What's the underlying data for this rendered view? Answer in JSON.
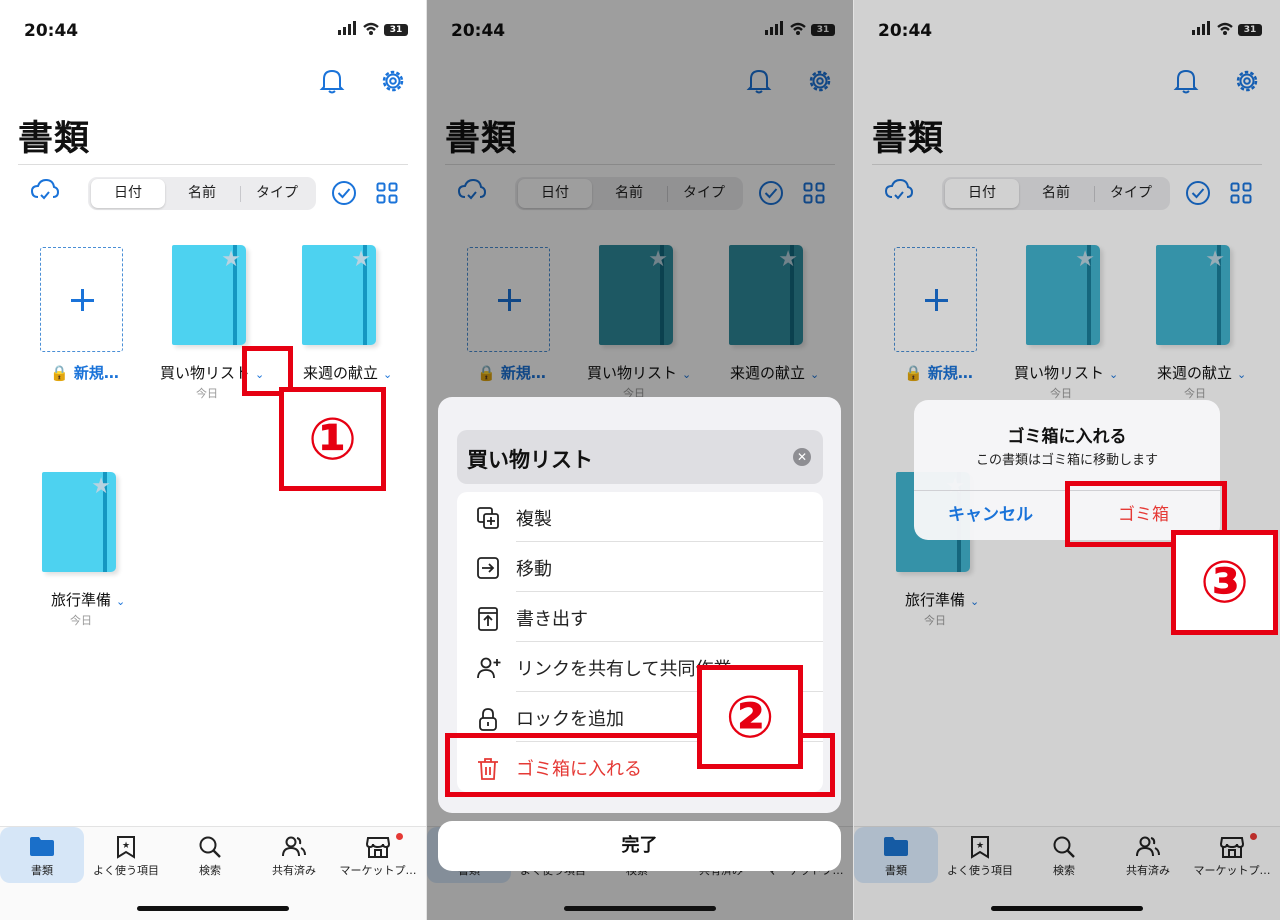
{
  "status": {
    "time": "20:44",
    "battery": "31"
  },
  "docs": {
    "title": "書類",
    "segments": [
      "日付",
      "名前",
      "タイプ"
    ],
    "new_label": "新規…",
    "notebooks": [
      {
        "name": "買い物リスト",
        "date": "今日"
      },
      {
        "name": "来週の献立",
        "date": "今日"
      },
      {
        "name": "旅行準備",
        "date": "今日"
      }
    ]
  },
  "tabs": [
    {
      "label": "書類",
      "icon": "folder-icon"
    },
    {
      "label": "よく使う項目",
      "icon": "bookmark-star-icon"
    },
    {
      "label": "検索",
      "icon": "search-icon"
    },
    {
      "label": "共有済み",
      "icon": "people-icon"
    },
    {
      "label": "マーケットプ…",
      "icon": "store-icon"
    }
  ],
  "sheet": {
    "title": "買い物リスト",
    "items": [
      {
        "label": "複製",
        "icon": "duplicate-icon"
      },
      {
        "label": "移動",
        "icon": "move-icon"
      },
      {
        "label": "書き出す",
        "icon": "export-icon"
      },
      {
        "label": "リンクを共有して共同作業",
        "icon": "add-person-icon"
      },
      {
        "label": "ロックを追加",
        "icon": "lock-icon"
      },
      {
        "label": "ゴミ箱に入れる",
        "icon": "trash-icon"
      }
    ],
    "done": "完了"
  },
  "alert": {
    "title": "ゴミ箱に入れる",
    "message": "この書類はゴミ箱に移動します",
    "cancel": "キャンセル",
    "confirm": "ゴミ箱"
  },
  "annotations": [
    "①",
    "②",
    "③"
  ],
  "colors": {
    "accent": "#1a73d9",
    "notebook": "#4dd2f0",
    "danger": "#e53935",
    "callout": "#e60012"
  }
}
